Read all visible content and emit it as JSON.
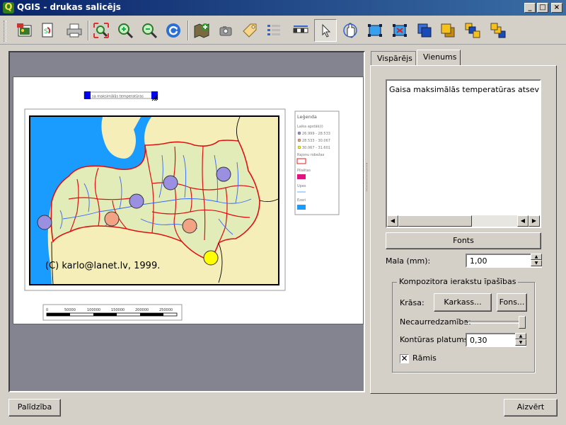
{
  "window": {
    "title": "QGIS - drukas salicējs",
    "app_icon_letter": "Q",
    "controls": {
      "minimize": "_",
      "maximize": "□",
      "close": "×"
    }
  },
  "toolbar": {
    "buttons": [
      {
        "name": "export-image-icon",
        "tooltip": ""
      },
      {
        "name": "export-svg-icon",
        "tooltip": ""
      },
      {
        "name": "print-icon",
        "tooltip": ""
      },
      {
        "name": "zoom-full-icon",
        "tooltip": ""
      },
      {
        "name": "zoom-in-icon",
        "tooltip": ""
      },
      {
        "name": "zoom-out-icon",
        "tooltip": ""
      },
      {
        "name": "refresh-icon",
        "tooltip": ""
      },
      {
        "name": "add-map-icon",
        "tooltip": ""
      },
      {
        "name": "add-image-icon",
        "tooltip": ""
      },
      {
        "name": "add-label-icon",
        "tooltip": ""
      },
      {
        "name": "add-legend-icon",
        "tooltip": ""
      },
      {
        "name": "add-scalebar-icon",
        "tooltip": ""
      },
      {
        "name": "select-move-icon",
        "tooltip": ""
      },
      {
        "name": "move-content-icon",
        "tooltip": ""
      },
      {
        "name": "group-icon",
        "tooltip": ""
      },
      {
        "name": "ungroup-icon",
        "tooltip": ""
      },
      {
        "name": "raise-icon",
        "tooltip": ""
      },
      {
        "name": "lower-icon",
        "tooltip": ""
      },
      {
        "name": "move-top-icon",
        "tooltip": ""
      },
      {
        "name": "move-bottom-icon",
        "tooltip": ""
      }
    ],
    "active_tool": "select-move-icon"
  },
  "composer": {
    "label_item_text": "sa maksimālās temperatūras",
    "map_copyright": "(C) karlo@lanet.lv, 1999.",
    "legend": {
      "title": "Leģenda",
      "items": [
        {
          "label": "Laika apstāk(i)",
          "kind": "header"
        },
        {
          "label": "26.999 - 28.533",
          "kind": "dot",
          "color": "#9a8fe0"
        },
        {
          "label": "28.533 - 30.067",
          "kind": "dot",
          "color": "#f2a384"
        },
        {
          "label": "30.067 - 31.601",
          "kind": "dot",
          "color": "#ffff00"
        },
        {
          "label": "Rajonu robežas",
          "kind": "header"
        },
        {
          "label": "",
          "kind": "box",
          "color": "#ffffff",
          "stroke": "#dd2222"
        },
        {
          "label": "Pilsētas",
          "kind": "header"
        },
        {
          "label": "",
          "kind": "box",
          "color": "#e0147e"
        },
        {
          "label": "Upes",
          "kind": "header"
        },
        {
          "label": "",
          "kind": "line",
          "color": "#3399ff"
        },
        {
          "label": "Ezeri",
          "kind": "header"
        },
        {
          "label": "",
          "kind": "box",
          "color": "#1a9cff"
        }
      ]
    },
    "scalebar_labels": [
      "0",
      "50000",
      "100000",
      "150000",
      "200000",
      "250000"
    ],
    "points": [
      {
        "cat": 0,
        "lat": 56.97,
        "lon": 24.1
      },
      {
        "cat": 0,
        "lat": 57.15,
        "lon": 25.0
      },
      {
        "cat": 0,
        "lat": 57.22,
        "lon": 26.6
      },
      {
        "cat": 0,
        "lat": 56.68,
        "lon": 21.2
      },
      {
        "cat": 1,
        "lat": 56.73,
        "lon": 22.9
      },
      {
        "cat": 1,
        "lat": 56.54,
        "lon": 25.9
      },
      {
        "cat": 2,
        "lat": 55.95,
        "lon": 26.4
      }
    ]
  },
  "panel": {
    "tabs": [
      {
        "label": "Vispārējs",
        "active": false
      },
      {
        "label": "Vienums",
        "active": true
      }
    ],
    "text_content": "Gaisa maksimālās temperatūras atsevišķās La",
    "fonts_button": "Fonts",
    "margin_label": "Mala (mm):",
    "margin_value": "1,00",
    "group_title": "Kompozitora ierakstu īpašības",
    "color_label": "Krāsa:",
    "frame_button": "Karkass...",
    "background_button": "Fons...",
    "transparency_label": "Necaurredzamība:",
    "transparency_value": 1.0,
    "outline_label": "Kontūras platums",
    "outline_value": "0,30",
    "frame_checkbox_label": "Rāmis",
    "frame_checked": true
  },
  "footer": {
    "help_button": "Palīdzība",
    "close_button": "Aizvērt"
  },
  "colors": {
    "map_land": "#e2ecb8",
    "map_sea": "#1a9cff",
    "districts": "#dd1111",
    "rivers": "#3366ff",
    "neighbours": "#f5eeb9"
  }
}
